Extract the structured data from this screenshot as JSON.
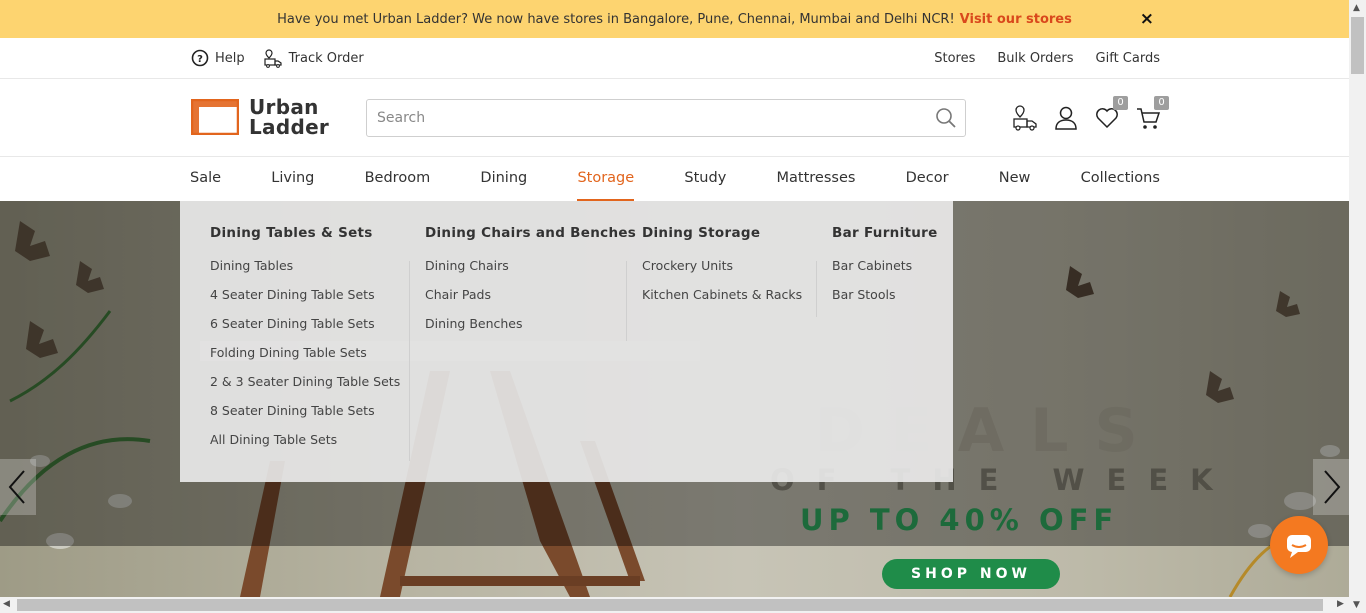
{
  "announcement": {
    "text": "Have you met Urban Ladder? We now have stores in Bangalore, Pune, Chennai, Mumbai and Delhi NCR!",
    "link": "Visit our stores",
    "close": "×"
  },
  "utility": {
    "help": "Help",
    "track_order": "Track Order",
    "stores": "Stores",
    "bulk_orders": "Bulk Orders",
    "gift_cards": "Gift Cards"
  },
  "logo": {
    "line1": "Urban",
    "line2": "Ladder"
  },
  "search": {
    "placeholder": "Search"
  },
  "header_icons": {
    "wishlist_count": "0",
    "cart_count": "0"
  },
  "nav": [
    {
      "label": "Sale"
    },
    {
      "label": "Living"
    },
    {
      "label": "Bedroom"
    },
    {
      "label": "Dining"
    },
    {
      "label": "Storage"
    },
    {
      "label": "Study"
    },
    {
      "label": "Mattresses"
    },
    {
      "label": "Decor"
    },
    {
      "label": "New"
    },
    {
      "label": "Collections"
    }
  ],
  "dropdown": {
    "columns": [
      {
        "heading": "Dining Tables & Sets",
        "items": [
          "Dining Tables",
          "4 Seater Dining Table Sets",
          "6 Seater Dining Table Sets",
          "Folding Dining Table Sets",
          "2 & 3 Seater Dining Table Sets",
          "8 Seater Dining Table Sets",
          "All Dining Table Sets"
        ]
      },
      {
        "heading": "Dining Chairs and Benches",
        "items": [
          "Dining Chairs",
          "Chair Pads",
          "Dining Benches"
        ]
      },
      {
        "heading": "Dining Storage",
        "items": [
          "Crockery Units",
          "Kitchen Cabinets & Racks"
        ]
      },
      {
        "heading": "Bar Furniture",
        "items": [
          "Bar Cabinets",
          "Bar Stools"
        ]
      }
    ]
  },
  "hero": {
    "deals": "DEALS",
    "of_the_week": "OF THE WEEK",
    "up_to": "UP TO 40% OFF",
    "shop_now": "SHOP NOW"
  },
  "colors": {
    "announcement_bg": "#fdd470",
    "accent": "#e2651d",
    "link": "#d9481c",
    "cta_green": "#1f8c49",
    "chat": "#f47920"
  },
  "icons": [
    "help-icon",
    "truck-icon",
    "search-icon",
    "delivery-truck-icon",
    "user-icon",
    "heart-icon",
    "cart-icon",
    "chevron-left-icon",
    "chevron-right-icon",
    "chat-icon",
    "close-icon"
  ]
}
